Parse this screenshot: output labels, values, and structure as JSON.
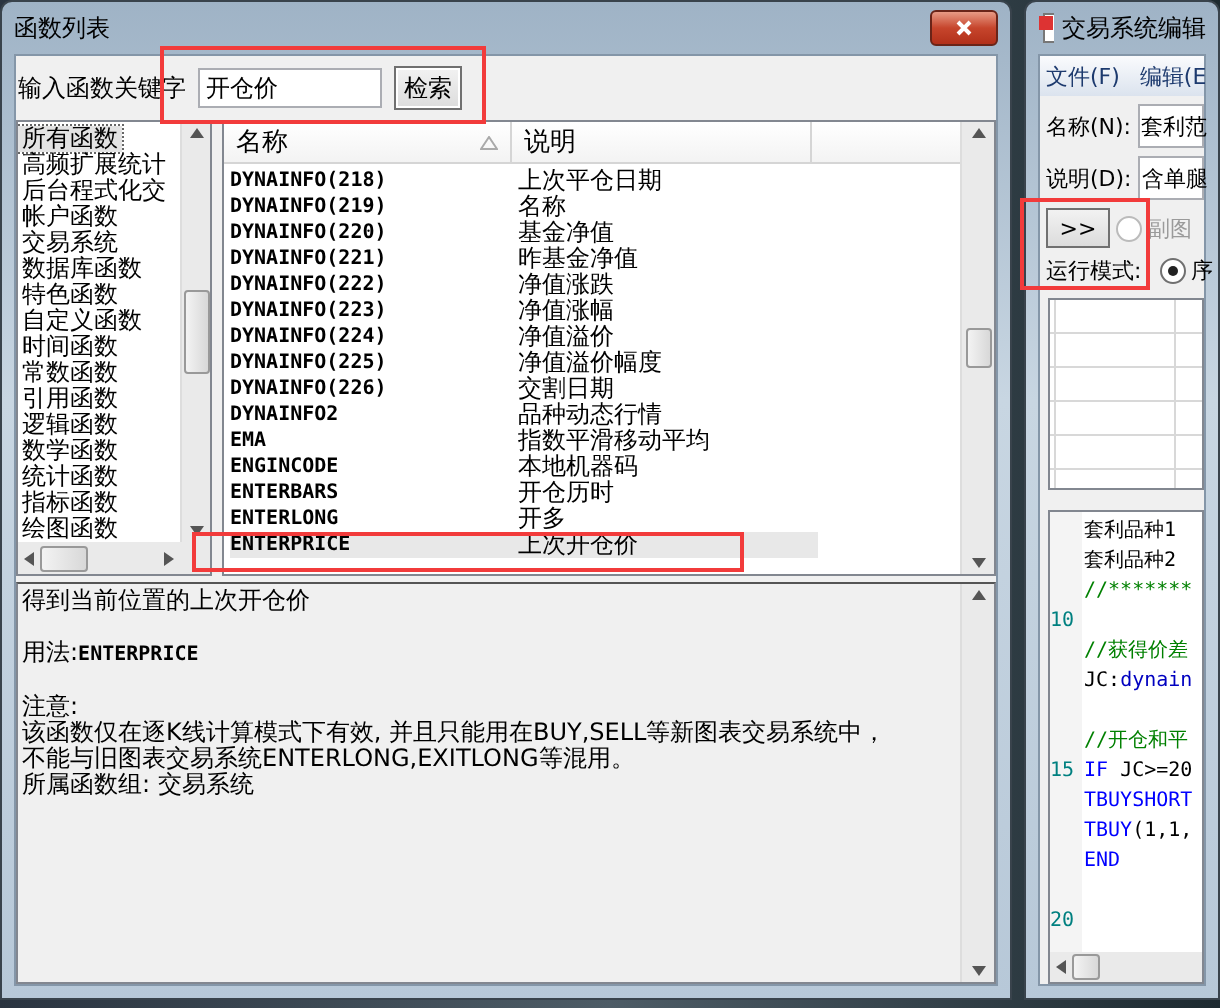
{
  "function_list_window": {
    "title": "函数列表",
    "search": {
      "label": "输入函数关键字",
      "value": "开仓价",
      "button": "检索"
    },
    "categories": [
      {
        "label": "所有函数",
        "selected": true
      },
      {
        "label": "高频扩展统计",
        "selected": false
      },
      {
        "label": "后台程式化交",
        "selected": false
      },
      {
        "label": "帐户函数",
        "selected": false
      },
      {
        "label": "交易系统",
        "selected": false
      },
      {
        "label": "数据库函数",
        "selected": false
      },
      {
        "label": "特色函数",
        "selected": false
      },
      {
        "label": "自定义函数",
        "selected": false
      },
      {
        "label": "时间函数",
        "selected": false
      },
      {
        "label": "常数函数",
        "selected": false
      },
      {
        "label": "引用函数",
        "selected": false
      },
      {
        "label": "逻辑函数",
        "selected": false
      },
      {
        "label": "数学函数",
        "selected": false
      },
      {
        "label": "统计函数",
        "selected": false
      },
      {
        "label": "指标函数",
        "selected": false
      },
      {
        "label": "绘图函数",
        "selected": false
      }
    ],
    "table": {
      "columns": [
        "名称",
        "说明"
      ],
      "rows": [
        {
          "name": "DYNAINFO(218)",
          "description": "上次平仓日期",
          "selected": false
        },
        {
          "name": "DYNAINFO(219)",
          "description": "名称",
          "selected": false
        },
        {
          "name": "DYNAINFO(220)",
          "description": "基金净值",
          "selected": false
        },
        {
          "name": "DYNAINFO(221)",
          "description": "昨基金净值",
          "selected": false
        },
        {
          "name": "DYNAINFO(222)",
          "description": "净值涨跌",
          "selected": false
        },
        {
          "name": "DYNAINFO(223)",
          "description": "净值涨幅",
          "selected": false
        },
        {
          "name": "DYNAINFO(224)",
          "description": "净值溢价",
          "selected": false
        },
        {
          "name": "DYNAINFO(225)",
          "description": "净值溢价幅度",
          "selected": false
        },
        {
          "name": "DYNAINFO(226)",
          "description": "交割日期",
          "selected": false
        },
        {
          "name": "DYNAINFO2",
          "description": "品种动态行情",
          "selected": false
        },
        {
          "name": "EMA",
          "description": "指数平滑移动平均",
          "selected": false
        },
        {
          "name": "ENGINCODE",
          "description": "本地机器码",
          "selected": false
        },
        {
          "name": "ENTERBARS",
          "description": "开仓历时",
          "selected": false
        },
        {
          "name": "ENTERLONG",
          "description": "开多",
          "selected": false
        },
        {
          "name": "ENTERPRICE",
          "description": "上次开仓价",
          "selected": true
        }
      ]
    },
    "details": {
      "summary": "得到当前位置的上次开仓价",
      "usage": "用法:ENTERPRICE",
      "note_heading": "注意:",
      "note": "该函数仅在逐K线计算模式下有效, 并且只能用在BUY,SELL等新图表交易系统中，不能与旧图表交易系统ENTERLONG,EXITLONG等混用。",
      "group": "所属函数组: 交易系统"
    }
  },
  "editor_window": {
    "title": "交易系统编辑",
    "menu": [
      "文件(F)",
      "编辑(E"
    ],
    "fields": [
      {
        "label": "名称(N):",
        "value": "套利范"
      },
      {
        "label": "说明(D):",
        "value": "含单腿"
      }
    ],
    "expand_button": ">>",
    "chart_option": {
      "label": "副图",
      "checked": false,
      "disabled": true
    },
    "run_mode": {
      "label": "运行模式:",
      "option": {
        "label": "序",
        "checked": true,
        "disabled": false
      }
    },
    "code": [
      {
        "kind": "code",
        "segments": [
          {
            "text": "套利品种1",
            "kind": "plain"
          }
        ]
      },
      {
        "kind": "code",
        "segments": [
          {
            "text": "套利品种2",
            "kind": "plain"
          }
        ]
      },
      {
        "kind": "code",
        "segments": [
          {
            "text": "//*******",
            "kind": "comment"
          }
        ]
      },
      {
        "kind": "blank",
        "number": "10"
      },
      {
        "kind": "code",
        "segments": [
          {
            "text": "//获得价差",
            "kind": "comment"
          }
        ]
      },
      {
        "kind": "code",
        "segments": [
          {
            "text": "JC:",
            "kind": "plain"
          },
          {
            "text": "dynain",
            "kind": "function"
          }
        ]
      },
      {
        "kind": "blank"
      },
      {
        "kind": "code",
        "segments": [
          {
            "text": "//开仓和平",
            "kind": "comment"
          }
        ]
      },
      {
        "kind": "code",
        "number": "15",
        "segments": [
          {
            "text": "IF",
            "kind": "keyword"
          },
          {
            "text": " JC>=20",
            "kind": "plain"
          }
        ]
      },
      {
        "kind": "code",
        "segments": [
          {
            "text": "TBUYSHORT",
            "kind": "keyword"
          }
        ]
      },
      {
        "kind": "code",
        "segments": [
          {
            "text": "TBUY",
            "kind": "keyword"
          },
          {
            "text": "(1,1,",
            "kind": "plain"
          }
        ]
      },
      {
        "kind": "code",
        "segments": [
          {
            "text": "END",
            "kind": "keyword"
          }
        ]
      },
      {
        "kind": "blank"
      },
      {
        "kind": "blank",
        "number": "20"
      }
    ]
  }
}
